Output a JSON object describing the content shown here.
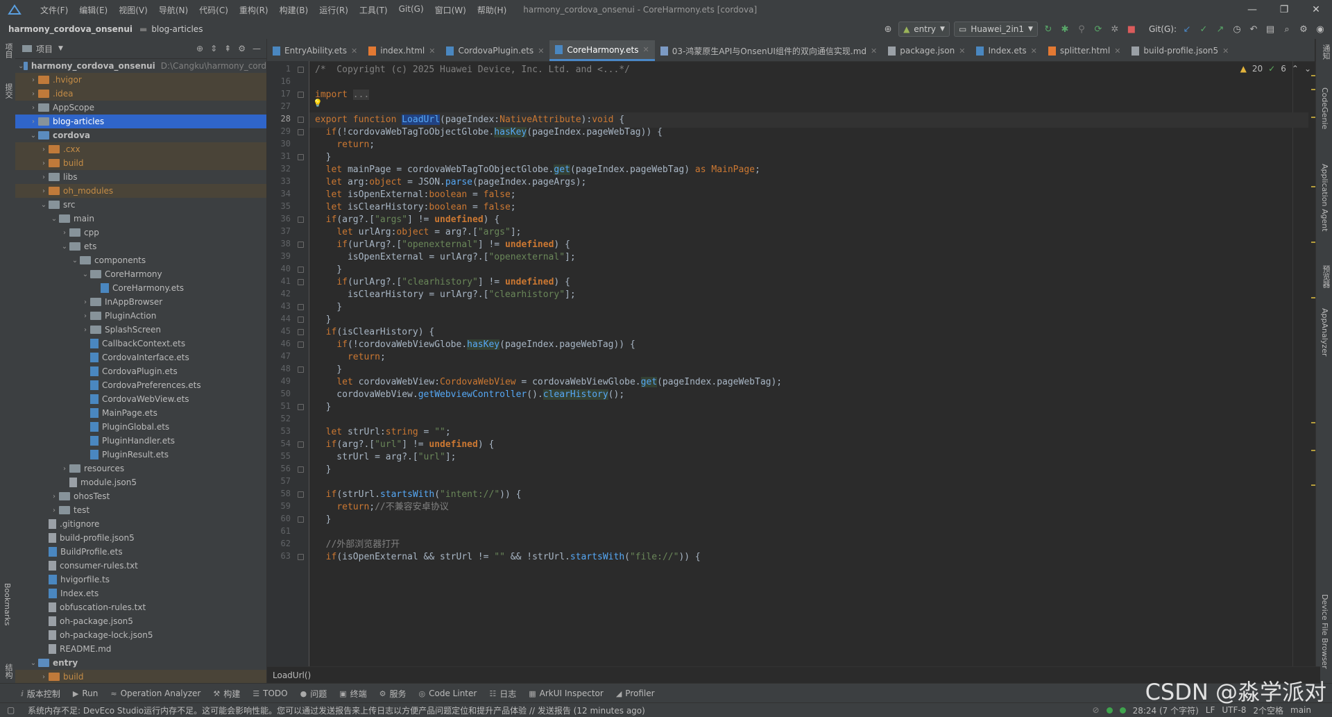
{
  "menubar": {
    "items": [
      "文件(F)",
      "编辑(E)",
      "视图(V)",
      "导航(N)",
      "代码(C)",
      "重构(R)",
      "构建(B)",
      "运行(R)",
      "工具(T)",
      "Git(G)",
      "窗口(W)",
      "帮助(H)"
    ],
    "window_title": "harmony_cordova_onsenui - CoreHarmony.ets [cordova]"
  },
  "navbar": {
    "project": "harmony_cordova_onsenui",
    "folder": "blog-articles",
    "run_config": "entry",
    "device": "Huawei_2in1",
    "git_label": "Git(G):"
  },
  "leftstrip": {
    "project": "项目",
    "commit": "提交",
    "bookmarks": "Bookmarks",
    "structure": "结构"
  },
  "project_panel": {
    "title": "项目",
    "rows": [
      {
        "label": "harmony_cordova_onsenui",
        "hint": "D:\\Cangku\\harmony_cord",
        "depth": 0,
        "expanded": true,
        "kind": "folder-blue",
        "bold": true
      },
      {
        "label": ".hvigor",
        "depth": 1,
        "expanded": false,
        "kind": "folder-orange",
        "state": "excl"
      },
      {
        "label": ".idea",
        "depth": 1,
        "expanded": false,
        "kind": "folder-orange",
        "state": "excl"
      },
      {
        "label": "AppScope",
        "depth": 1,
        "expanded": false,
        "kind": "folder"
      },
      {
        "label": "blog-articles",
        "depth": 1,
        "expanded": false,
        "kind": "folder",
        "state": "sel"
      },
      {
        "label": "cordova",
        "depth": 1,
        "expanded": true,
        "kind": "folder-blue",
        "bold": true
      },
      {
        "label": ".cxx",
        "depth": 2,
        "expanded": false,
        "kind": "folder-orange",
        "state": "excl"
      },
      {
        "label": "build",
        "depth": 2,
        "expanded": false,
        "kind": "folder-orange",
        "state": "excl"
      },
      {
        "label": "libs",
        "depth": 2,
        "expanded": false,
        "kind": "folder"
      },
      {
        "label": "oh_modules",
        "depth": 2,
        "expanded": false,
        "kind": "folder-orange",
        "state": "excl"
      },
      {
        "label": "src",
        "depth": 2,
        "expanded": true,
        "kind": "folder"
      },
      {
        "label": "main",
        "depth": 3,
        "expanded": true,
        "kind": "folder"
      },
      {
        "label": "cpp",
        "depth": 4,
        "expanded": false,
        "kind": "folder"
      },
      {
        "label": "ets",
        "depth": 4,
        "expanded": true,
        "kind": "folder"
      },
      {
        "label": "components",
        "depth": 5,
        "expanded": true,
        "kind": "folder"
      },
      {
        "label": "CoreHarmony",
        "depth": 6,
        "expanded": true,
        "kind": "folder"
      },
      {
        "label": "CoreHarmony.ets",
        "depth": 7,
        "kind": "ets"
      },
      {
        "label": "InAppBrowser",
        "depth": 6,
        "expanded": false,
        "kind": "folder"
      },
      {
        "label": "PluginAction",
        "depth": 6,
        "expanded": false,
        "kind": "folder"
      },
      {
        "label": "SplashScreen",
        "depth": 6,
        "expanded": false,
        "kind": "folder"
      },
      {
        "label": "CallbackContext.ets",
        "depth": 6,
        "kind": "ets"
      },
      {
        "label": "CordovaInterface.ets",
        "depth": 6,
        "kind": "ets"
      },
      {
        "label": "CordovaPlugin.ets",
        "depth": 6,
        "kind": "ets"
      },
      {
        "label": "CordovaPreferences.ets",
        "depth": 6,
        "kind": "ets"
      },
      {
        "label": "CordovaWebView.ets",
        "depth": 6,
        "kind": "ets"
      },
      {
        "label": "MainPage.ets",
        "depth": 6,
        "kind": "ets"
      },
      {
        "label": "PluginGlobal.ets",
        "depth": 6,
        "kind": "ets"
      },
      {
        "label": "PluginHandler.ets",
        "depth": 6,
        "kind": "ets"
      },
      {
        "label": "PluginResult.ets",
        "depth": 6,
        "kind": "ets"
      },
      {
        "label": "resources",
        "depth": 4,
        "expanded": false,
        "kind": "folder"
      },
      {
        "label": "module.json5",
        "depth": 4,
        "kind": "txt"
      },
      {
        "label": "ohosTest",
        "depth": 3,
        "expanded": false,
        "kind": "folder"
      },
      {
        "label": "test",
        "depth": 3,
        "expanded": false,
        "kind": "folder"
      },
      {
        "label": ".gitignore",
        "depth": 2,
        "kind": "txt"
      },
      {
        "label": "build-profile.json5",
        "depth": 2,
        "kind": "txt"
      },
      {
        "label": "BuildProfile.ets",
        "depth": 2,
        "kind": "ets"
      },
      {
        "label": "consumer-rules.txt",
        "depth": 2,
        "kind": "txt"
      },
      {
        "label": "hvigorfile.ts",
        "depth": 2,
        "kind": "ets"
      },
      {
        "label": "Index.ets",
        "depth": 2,
        "kind": "ets"
      },
      {
        "label": "obfuscation-rules.txt",
        "depth": 2,
        "kind": "txt"
      },
      {
        "label": "oh-package.json5",
        "depth": 2,
        "kind": "txt"
      },
      {
        "label": "oh-package-lock.json5",
        "depth": 2,
        "kind": "txt"
      },
      {
        "label": "README.md",
        "depth": 2,
        "kind": "txt"
      },
      {
        "label": "entry",
        "depth": 1,
        "expanded": true,
        "kind": "folder-blue",
        "bold": true
      },
      {
        "label": "build",
        "depth": 2,
        "expanded": false,
        "kind": "folder-orange",
        "state": "excl"
      }
    ]
  },
  "tabs": [
    {
      "label": "EntryAbility.ets",
      "kind": "ets",
      "active": false
    },
    {
      "label": "index.html",
      "kind": "html",
      "active": false
    },
    {
      "label": "CordovaPlugin.ets",
      "kind": "ets",
      "active": false
    },
    {
      "label": "CoreHarmony.ets",
      "kind": "ets",
      "active": true
    },
    {
      "label": "03-鸿蒙原生API与OnsenUI组件的双向通信实现.md",
      "kind": "md",
      "active": false
    },
    {
      "label": "package.json",
      "kind": "json",
      "active": false
    },
    {
      "label": "Index.ets",
      "kind": "ets",
      "active": false
    },
    {
      "label": "splitter.html",
      "kind": "html",
      "active": false
    },
    {
      "label": "build-profile.json5",
      "kind": "json",
      "active": false
    }
  ],
  "inspection": {
    "warnings": "20",
    "ok": "6"
  },
  "code_lines": [
    {
      "n": "1",
      "html": "<span class=\"cm\">/*  Copyright (c) 2025 Huawei Device, Inc. Ltd. and &lt;...*/</span>"
    },
    {
      "n": "16",
      "html": ""
    },
    {
      "n": "17",
      "html": "<span class=\"kw\">import</span> <span class=\"cm\" style=\"background:#3a3a3a\">...</span>"
    },
    {
      "n": "27",
      "html": ""
    },
    {
      "n": "28",
      "html": "<span class=\"kw\">export function</span> <span class=\"sel-word\">LoadUrl</span>(pageIndex:<span class=\"ty\">NativeAttribute</span>):<span class=\"kw\">void</span> {",
      "current": true
    },
    {
      "n": "29",
      "html": "  <span class=\"kw\">if</span>(!cordovaWebTagToObjectGlobe.<span class=\"mt hl\">hasKey</span>(pageIndex.pageWebTag)) {"
    },
    {
      "n": "30",
      "html": "    <span class=\"kw\">return</span>;"
    },
    {
      "n": "31",
      "html": "  }"
    },
    {
      "n": "32",
      "html": "  <span class=\"kw\">let</span> mainPage = cordovaWebTagToObjectGlobe.<span class=\"mt hl\">get</span>(pageIndex.pageWebTag) <span class=\"kw\">as</span> <span class=\"ty\">MainPage</span>;"
    },
    {
      "n": "33",
      "html": "  <span class=\"kw\">let</span> arg:<span class=\"kw\">object</span> = JSON.<span class=\"mt\">parse</span>(pageIndex.pageArgs);"
    },
    {
      "n": "34",
      "html": "  <span class=\"kw\">let</span> isOpenExternal:<span class=\"kw\">boolean</span> = <span class=\"kw\">false</span>;"
    },
    {
      "n": "35",
      "html": "  <span class=\"kw\">let</span> isClearHistory:<span class=\"kw\">boolean</span> = <span class=\"kw\">false</span>;"
    },
    {
      "n": "36",
      "html": "  <span class=\"kw\">if</span>(arg?.[<span class=\"str\">\"args\"</span>] != <span class=\"undef\">undefined</span>) {"
    },
    {
      "n": "37",
      "html": "    <span class=\"kw\">let</span> urlArg:<span class=\"kw\">object</span> = arg?.[<span class=\"str\">\"args\"</span>];"
    },
    {
      "n": "38",
      "html": "    <span class=\"kw\">if</span>(urlArg?.[<span class=\"str\">\"openexternal\"</span>] != <span class=\"undef\">undefined</span>) {"
    },
    {
      "n": "39",
      "html": "      isOpenExternal = urlArg?.[<span class=\"str\">\"openexternal\"</span>];"
    },
    {
      "n": "40",
      "html": "    }"
    },
    {
      "n": "41",
      "html": "    <span class=\"kw\">if</span>(urlArg?.[<span class=\"str\">\"clearhistory\"</span>] != <span class=\"undef\">undefined</span>) {"
    },
    {
      "n": "42",
      "html": "      isClearHistory = urlArg?.[<span class=\"str\">\"clearhistory\"</span>];"
    },
    {
      "n": "43",
      "html": "    }"
    },
    {
      "n": "44",
      "html": "  }"
    },
    {
      "n": "45",
      "html": "  <span class=\"kw\">if</span>(isClearHistory) {"
    },
    {
      "n": "46",
      "html": "    <span class=\"kw\">if</span>(!cordovaWebViewGlobe.<span class=\"mt hl\">hasKey</span>(pageIndex.pageWebTag)) {"
    },
    {
      "n": "47",
      "html": "      <span class=\"kw\">return</span>;"
    },
    {
      "n": "48",
      "html": "    }"
    },
    {
      "n": "49",
      "html": "    <span class=\"kw\">let</span> cordovaWebView:<span class=\"ty\">CordovaWebView</span> = cordovaWebViewGlobe.<span class=\"mt hl\">get</span>(pageIndex.pageWebTag);"
    },
    {
      "n": "50",
      "html": "    cordovaWebView.<span class=\"mt\">getWebviewController</span>().<span class=\"mt hl\">clearHistory</span>();"
    },
    {
      "n": "51",
      "html": "  }"
    },
    {
      "n": "52",
      "html": ""
    },
    {
      "n": "53",
      "html": "  <span class=\"kw\">let</span> strUrl:<span class=\"kw\">string</span> = <span class=\"str\">\"\"</span>;"
    },
    {
      "n": "54",
      "html": "  <span class=\"kw\">if</span>(arg?.[<span class=\"str\">\"url\"</span>] != <span class=\"undef\">undefined</span>) {"
    },
    {
      "n": "55",
      "html": "    strUrl = arg?.[<span class=\"str\">\"url\"</span>];"
    },
    {
      "n": "56",
      "html": "  }"
    },
    {
      "n": "57",
      "html": ""
    },
    {
      "n": "58",
      "html": "  <span class=\"kw\">if</span>(strUrl.<span class=\"mt\">startsWith</span>(<span class=\"str\">\"intent://\"</span>)) {"
    },
    {
      "n": "59",
      "html": "    <span class=\"kw\">return</span>;<span class=\"cm\">//不兼容安卓协议</span>"
    },
    {
      "n": "60",
      "html": "  }"
    },
    {
      "n": "61",
      "html": ""
    },
    {
      "n": "62",
      "html": "  <span class=\"cm\">//外部浏览器打开</span>"
    },
    {
      "n": "63",
      "html": "  <span class=\"kw\">if</span>(isOpenExternal &amp;&amp; strUrl != <span class=\"str\">\"\"</span> &amp;&amp; !strUrl.<span class=\"mt\">startsWith</span>(<span class=\"str\">\"file://\"</span>)) {"
    }
  ],
  "breadcrumb_bottom": "LoadUrl()",
  "toolwindows": [
    {
      "icon": "ⅈ",
      "label": "版本控制"
    },
    {
      "icon": "▶",
      "label": "Run"
    },
    {
      "icon": "≈",
      "label": "Operation Analyzer"
    },
    {
      "icon": "⚒",
      "label": "构建"
    },
    {
      "icon": "☰",
      "label": "TODO"
    },
    {
      "icon": "●",
      "label": "问题"
    },
    {
      "icon": "▣",
      "label": "终端"
    },
    {
      "icon": "⚙",
      "label": "服务"
    },
    {
      "icon": "◎",
      "label": "Code Linter"
    },
    {
      "icon": "☷",
      "label": "日志"
    },
    {
      "icon": "▦",
      "label": "ArkUI Inspector"
    },
    {
      "icon": "◢",
      "label": "Profiler"
    }
  ],
  "status": {
    "message": "系统内存不足: DevEco Studio运行内存不足。这可能会影响性能。您可以通过发送报告来上传日志以方便产品问题定位和提升产品体验 // 发送报告 (12 minutes ago)",
    "position": "28:24 (7 个字符)",
    "line_sep": "LF",
    "encoding": "UTF-8",
    "indent": "2个空格",
    "branch": "main"
  },
  "rightstrip": {
    "notifications": "通知",
    "codegenie": "CodeGenie",
    "agent": "Application Agent",
    "preview": "预览器",
    "analyzer": "AppAnalyzer",
    "device_files": "Device File Browser"
  },
  "watermark": "CSDN @淼学派对"
}
